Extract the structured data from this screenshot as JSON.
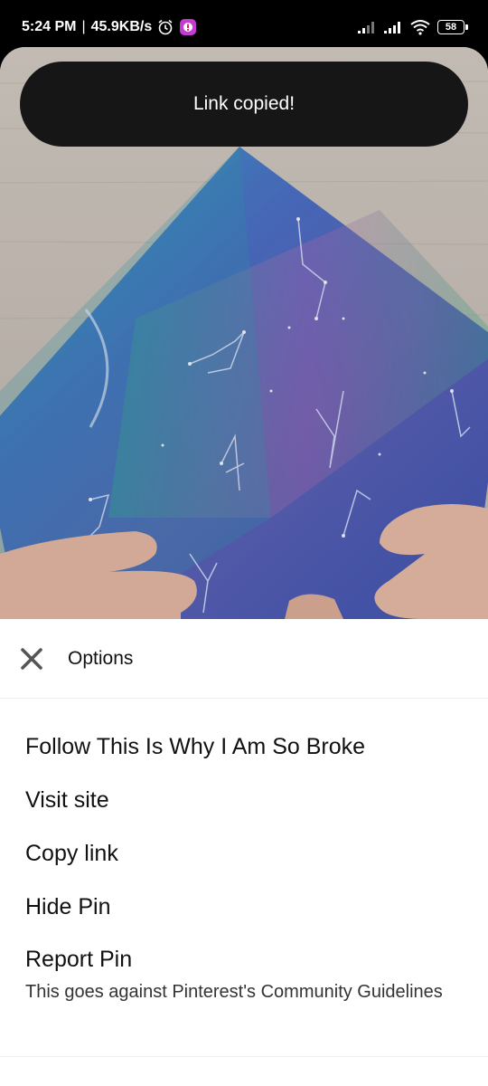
{
  "status_bar": {
    "time": "5:24 PM",
    "separator": "|",
    "network_speed": "45.9KB/s",
    "icons": [
      "alarm-icon",
      "app-notification-icon",
      "signal-1-icon",
      "signal-2-icon",
      "wifi-icon"
    ],
    "battery": "58"
  },
  "toast": {
    "message": "Link copied!"
  },
  "pin": {
    "image": "origami-paper-constellations"
  },
  "sheet": {
    "title": "Options",
    "close_icon": "close-icon",
    "options": [
      {
        "label": "Follow This Is Why I Am So Broke"
      },
      {
        "label": "Visit site"
      },
      {
        "label": "Copy link"
      },
      {
        "label": "Hide Pin"
      },
      {
        "label": "Report Pin",
        "sublabel": "This goes against Pinterest's Community Guidelines"
      }
    ]
  },
  "colors": {
    "toast_bg": "#161616",
    "sheet_bg": "#ffffff",
    "text_primary": "#111111"
  }
}
